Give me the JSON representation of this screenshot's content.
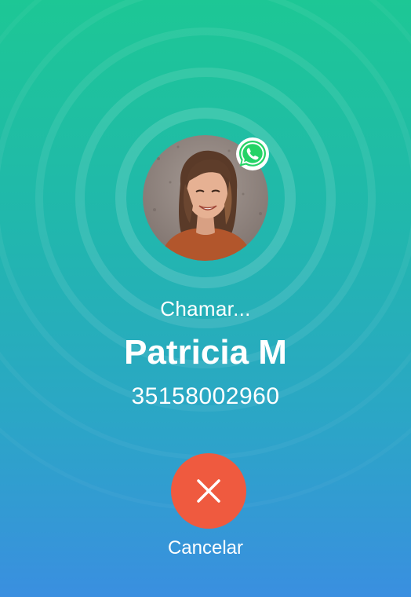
{
  "call": {
    "status": "Chamar...",
    "contact_name": "Patricia M",
    "phone_number": "35158002960",
    "app_icon": "whatsapp-icon",
    "avatar": "contact-photo"
  },
  "actions": {
    "cancel_label": "Cancelar",
    "cancel_icon": "close-icon",
    "cancel_color": "#ef5a3f"
  },
  "colors": {
    "background_top": "#1dc795",
    "background_bottom": "#3a8fe0",
    "whatsapp_green": "#25d366",
    "text": "#ffffff"
  }
}
